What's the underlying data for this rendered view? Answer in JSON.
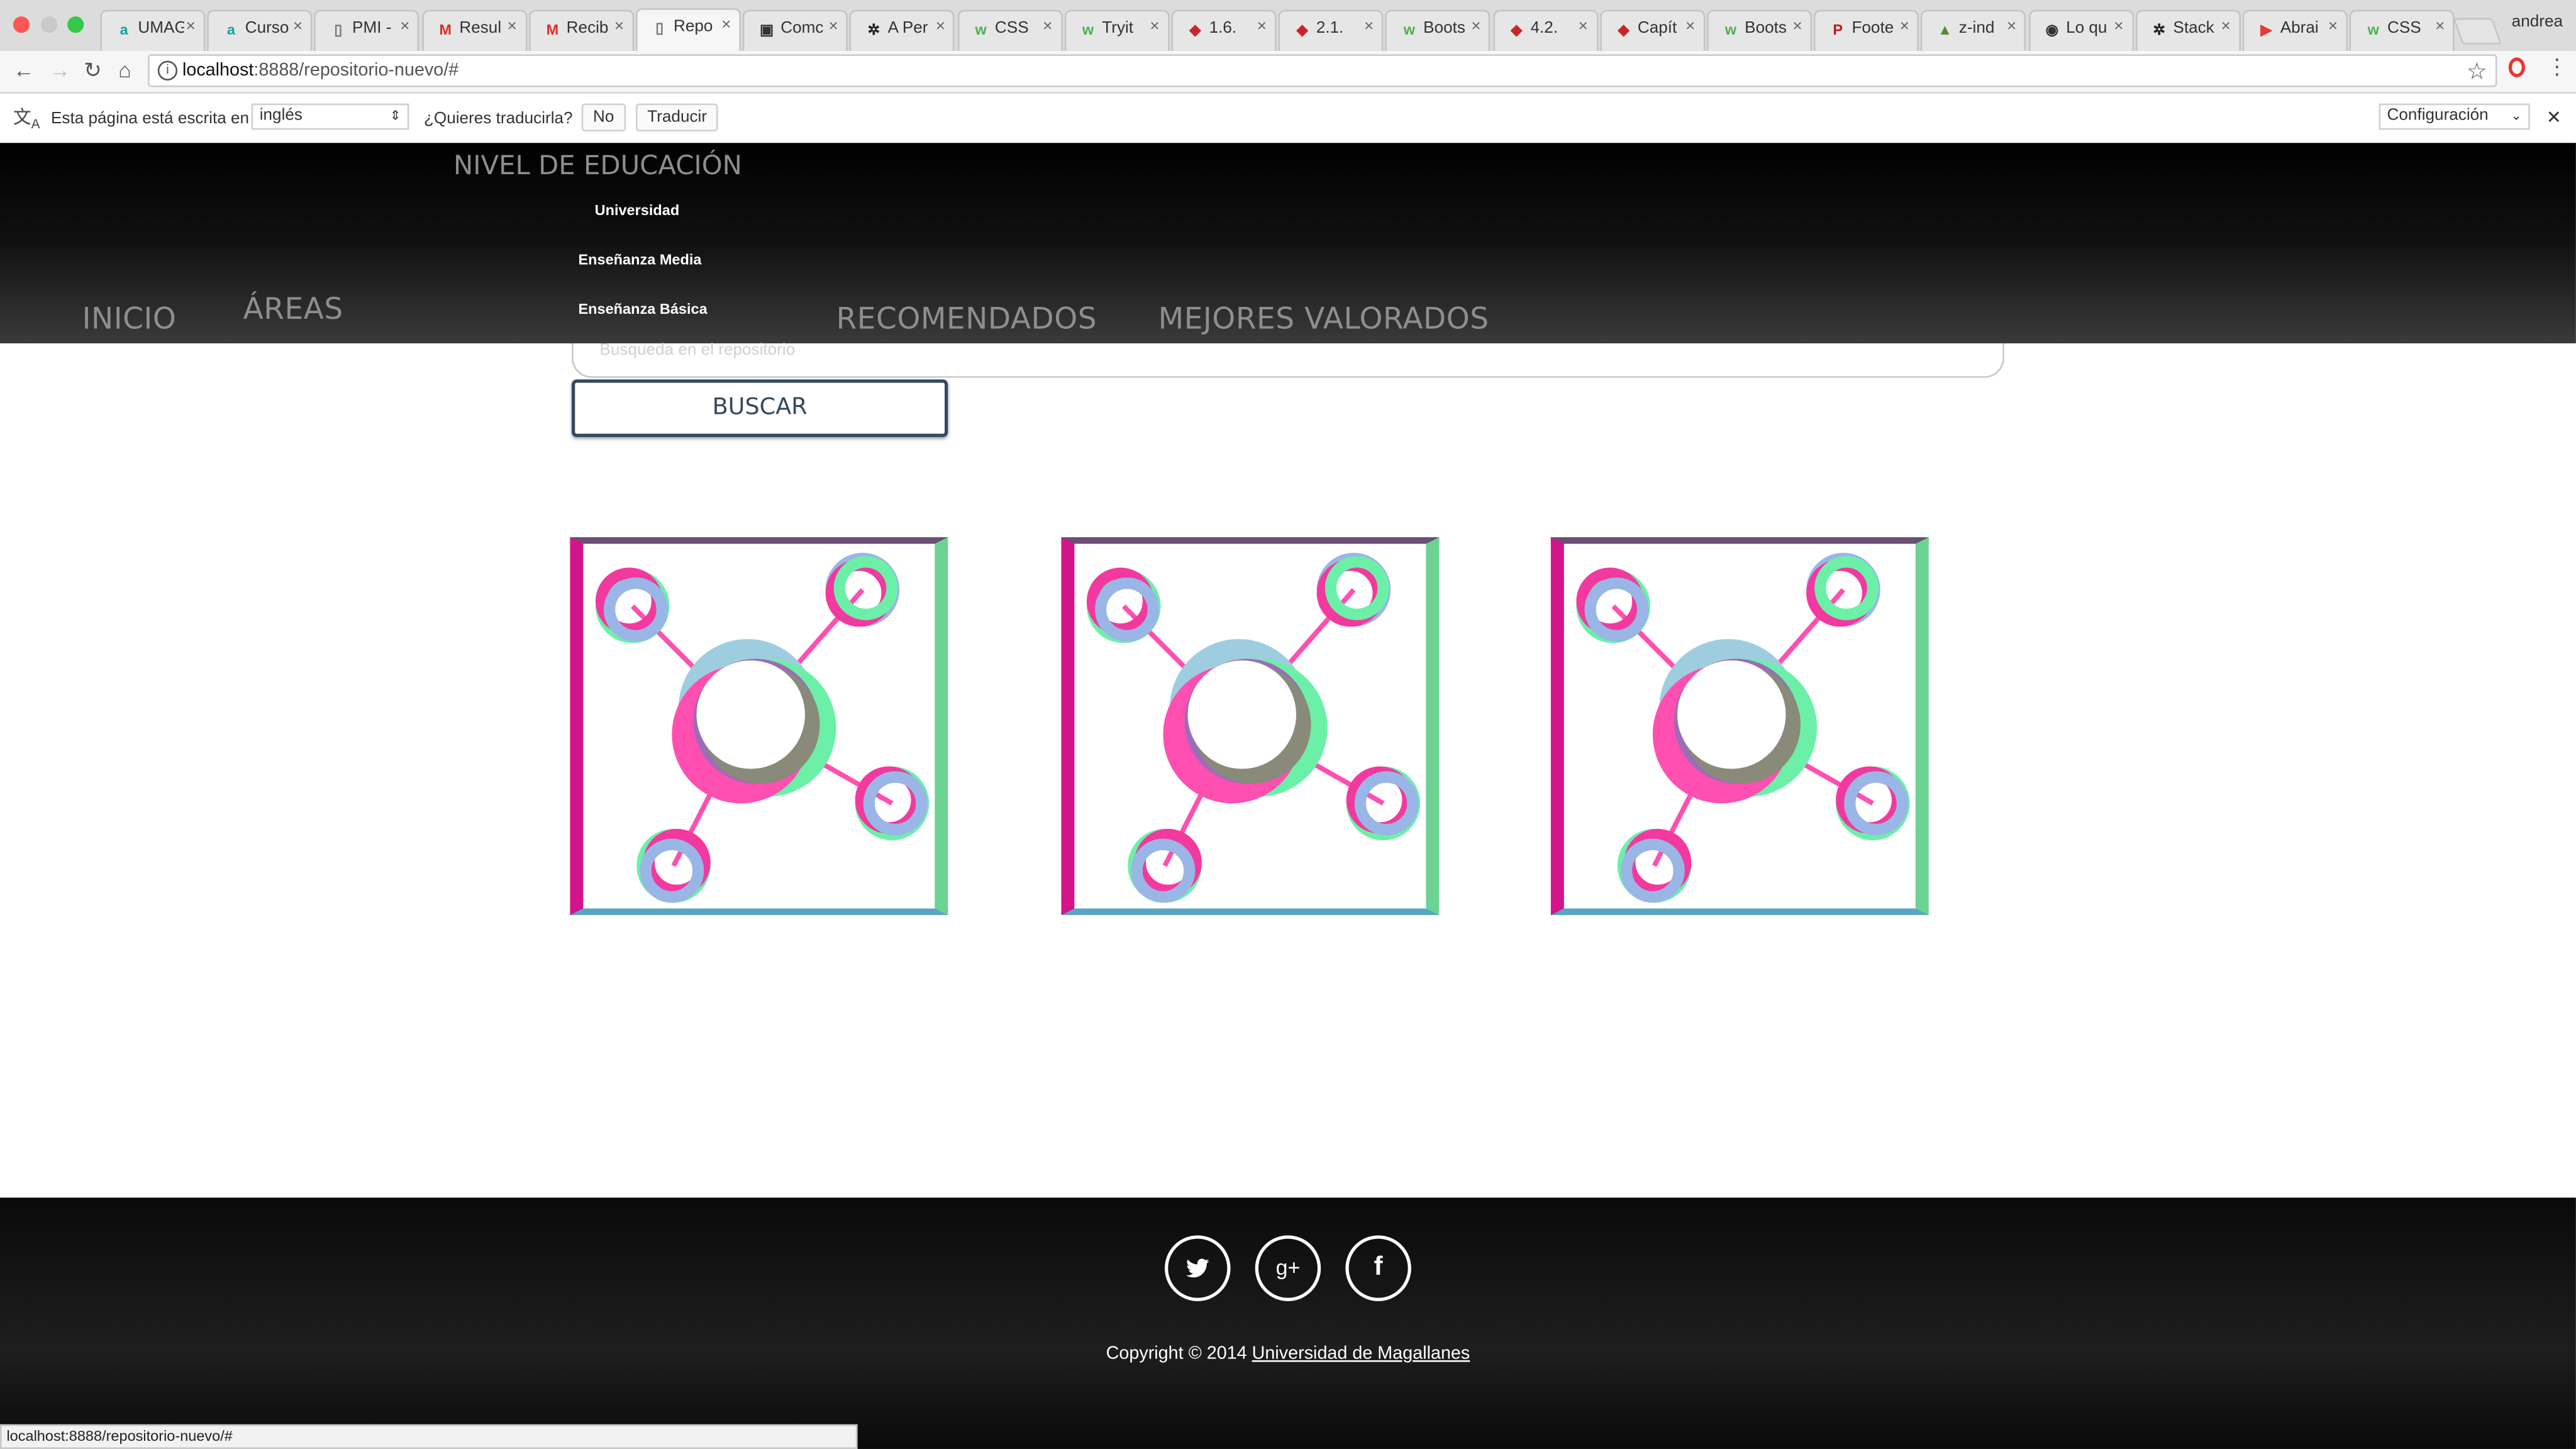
{
  "browser": {
    "profile": "andrea",
    "tabs": [
      {
        "title": "UMAG",
        "favicon_color": "#1aa39a",
        "favicon_glyph": "a"
      },
      {
        "title": "Curso",
        "favicon_color": "#1aa39a",
        "favicon_glyph": "a"
      },
      {
        "title": "PMI -",
        "favicon_color": "#777777",
        "favicon_glyph": "▯"
      },
      {
        "title": "Resul",
        "favicon_color": "#d93025",
        "favicon_glyph": "M"
      },
      {
        "title": "Recib",
        "favicon_color": "#d93025",
        "favicon_glyph": "M"
      },
      {
        "title": "Repo",
        "favicon_color": "#777777",
        "favicon_glyph": "▯"
      },
      {
        "title": "Comc",
        "favicon_color": "#333333",
        "favicon_glyph": "▣"
      },
      {
        "title": "A Per",
        "favicon_color": "#222222",
        "favicon_glyph": "✲"
      },
      {
        "title": "CSS",
        "favicon_color": "#4caf50",
        "favicon_glyph": "w"
      },
      {
        "title": "Tryit",
        "favicon_color": "#4caf50",
        "favicon_glyph": "w"
      },
      {
        "title": "1.6.",
        "favicon_color": "#c62828",
        "favicon_glyph": "◆"
      },
      {
        "title": "2.1.",
        "favicon_color": "#c62828",
        "favicon_glyph": "◆"
      },
      {
        "title": "Boots",
        "favicon_color": "#4caf50",
        "favicon_glyph": "w"
      },
      {
        "title": "4.2.",
        "favicon_color": "#c62828",
        "favicon_glyph": "◆"
      },
      {
        "title": "Capít",
        "favicon_color": "#c62828",
        "favicon_glyph": "◆"
      },
      {
        "title": "Boots",
        "favicon_color": "#4caf50",
        "favicon_glyph": "w"
      },
      {
        "title": "Foote",
        "favicon_color": "#b71c1c",
        "favicon_glyph": "P"
      },
      {
        "title": "z-ind",
        "favicon_color": "#558b2f",
        "favicon_glyph": "▲"
      },
      {
        "title": "Lo qu",
        "favicon_color": "#333333",
        "favicon_glyph": "◉"
      },
      {
        "title": "Stack",
        "favicon_color": "#222222",
        "favicon_glyph": "✲"
      },
      {
        "title": "Abrai",
        "favicon_color": "#e53935",
        "favicon_glyph": "▶"
      },
      {
        "title": "CSS",
        "favicon_color": "#4caf50",
        "favicon_glyph": "w"
      }
    ],
    "active_tab_index": 5,
    "url_host": "localhost",
    "url_rest": ":8888/repositorio-nuevo/#",
    "status_url": "localhost:8888/repositorio-nuevo/#"
  },
  "translate": {
    "message": "Esta página está escrita en",
    "language": "inglés",
    "question": "¿Quieres traducirla?",
    "no_label": "No",
    "translate_label": "Traducir",
    "settings_label": "Configuración"
  },
  "site": {
    "nav": {
      "inicio": "INICIO",
      "areas": "ÁREAS",
      "recomendados": "RECOMENDADOS",
      "mejores": "MEJORES VALORADOS"
    },
    "dropdown": {
      "title": "NIVEL DE EDUCACIÓN",
      "items": [
        "Universidad",
        "Enseñanza Media",
        "Enseñanza Básica"
      ]
    },
    "search": {
      "placeholder": "Busqueda en el repositorio",
      "button": "BUSCAR"
    },
    "footer": {
      "copyright": "Copyright © 2014",
      "link": "Universidad de Magallanes",
      "social": [
        "twitter-icon",
        "google-plus-icon",
        "facebook-icon"
      ]
    }
  },
  "colors": {
    "accent_navy": "#34495e",
    "magenta": "#d4148a",
    "green": "#6cd393",
    "blue": "#5aa6c0",
    "purple": "#6b4d75"
  }
}
